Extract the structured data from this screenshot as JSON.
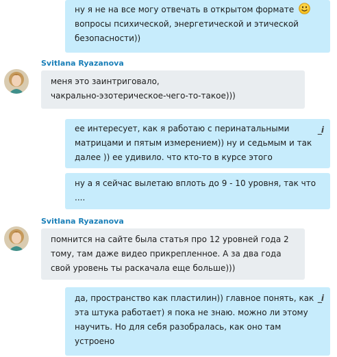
{
  "messages": [
    {
      "direction": "outgoing",
      "lines": [
        "ну я не на все могу отвечать в открытом формате",
        "вопросы психической, энергетической и этической",
        "безопасности))"
      ],
      "emoticon": "smiley-icon"
    },
    {
      "direction": "incoming",
      "sender": "Svitlana Ryazanova",
      "lines": [
        "меня это заинтриговало,",
        "чакрально-эзотерическое-чего-то-такое)))"
      ]
    },
    {
      "direction": "outgoing",
      "edited_icon": "edited-pencil-icon",
      "lines": [
        "ее интересует, как я работаю с перинатальными",
        "матрицами и пятым измерением)) ну и седьмым и так",
        "далее )) ее удивило. что кто-то в курсе этого"
      ]
    },
    {
      "direction": "outgoing",
      "lines": [
        "ну а я сейчас вылетаю вплоть до 9 - 10 уровня, так что",
        "...."
      ]
    },
    {
      "direction": "incoming",
      "sender": "Svitlana Ryazanova",
      "lines": [
        "помнится на сайте была статья про 12 уровней года 2",
        "тому, там даже видео прикрепленное. А за два года",
        "свой уровень ты раскачала еще больше)))"
      ]
    },
    {
      "direction": "outgoing",
      "edited_icon": "edited-pencil-icon",
      "lines": [
        "да, пространство как пластилин)) главное понять, как",
        "эта штука работает) я пока не знаю. можно ли этому",
        "научить. Но для себя разобралась, как оно там",
        "устроено"
      ]
    }
  ],
  "colors": {
    "outgoing_bubble": "#c7ecfc",
    "incoming_bubble": "#e9edf0",
    "sender_name": "#1a7fb8"
  }
}
